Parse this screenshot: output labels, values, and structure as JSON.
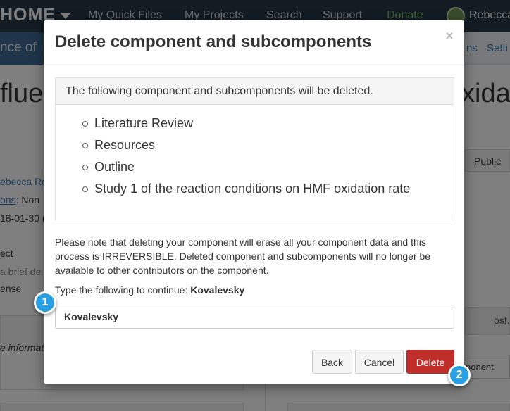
{
  "background": {
    "brand": "HOME",
    "nav": [
      {
        "label": "My Quick Files"
      },
      {
        "label": "My Projects"
      },
      {
        "label": "Search"
      },
      {
        "label": "Support"
      },
      {
        "label": "Donate"
      }
    ],
    "user_name": "Rebecca",
    "project_subtitle": "nce of",
    "subnav_links": [
      "ns",
      "Setti"
    ],
    "title_left": "fluen",
    "title_right": "xidat",
    "author": "ebecca Ros",
    "meta_link": "ons",
    "meta_rest": ": Non",
    "date": "18-01-30 (",
    "description_heading": "ect",
    "description_placeholder": "a brief de",
    "license": "ense",
    "panel_left_text": "e informat",
    "public_label": "Public",
    "osf_label": "osf.",
    "component_button": "ponent"
  },
  "modal": {
    "title": "Delete component and subcomponents",
    "close_label": "×",
    "list_heading": "The following component and subcomponents will be deleted.",
    "components": [
      "Literature Review",
      "Resources",
      "Outline",
      "Study 1 of the reaction conditions on HMF oxidation rate"
    ],
    "warning": "Please note that deleting your component will erase all your component data and this process is IRREVERSIBLE. Deleted component and subcomponents will no longer be available to other contributors on the component.",
    "prompt_label": "Type the following to continue:",
    "prompt_value": "Kovalevsky",
    "input_value": "Kovalevsky",
    "buttons": {
      "back": "Back",
      "cancel": "Cancel",
      "delete": "Delete"
    }
  },
  "markers": [
    "1",
    "2"
  ],
  "colors": {
    "navbar": "#263947",
    "danger": "#c12e2a",
    "marker": "#2aa0e4",
    "link": "#337ab7"
  }
}
